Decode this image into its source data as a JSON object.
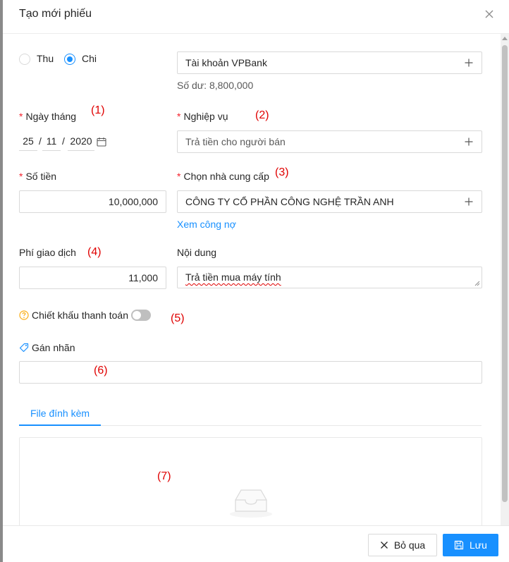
{
  "modal": {
    "title": "Tạo mới phiếu"
  },
  "type_radio": {
    "options": [
      {
        "label": "Thu",
        "checked": false
      },
      {
        "label": "Chi",
        "checked": true
      }
    ]
  },
  "account": {
    "value": "Tài khoản VPBank",
    "balance": "Số dư: 8,800,000"
  },
  "date_field": {
    "label": "Ngày tháng",
    "annotation": "(1)",
    "day": "25",
    "month": "11",
    "year": "2020",
    "separator": "/"
  },
  "operation": {
    "label": "Nghiệp vụ",
    "annotation": "(2)",
    "value": "Trả tiền cho người bán"
  },
  "amount": {
    "label": "Số tiền",
    "value": "10,000,000"
  },
  "supplier": {
    "label": "Chọn nhà cung cấp",
    "annotation": "(3)",
    "value": "CÔNG TY CỔ PHẦN CÔNG NGHỆ TRẦN ANH",
    "debt_link": "Xem công nợ"
  },
  "fee": {
    "label": "Phí giao dịch",
    "annotation": "(4)",
    "value": "11,000"
  },
  "content": {
    "label": "Nội dung",
    "value": "Trả tiền mua máy tính"
  },
  "discount": {
    "label": "Chiết khấu thanh toán",
    "annotation": "(5)",
    "enabled": false
  },
  "tags": {
    "label": "Gán nhãn",
    "annotation": "(6)"
  },
  "attachments": {
    "tab_label": "File đính kèm",
    "annotation": "(7)"
  },
  "footer": {
    "cancel_label": "Bỏ qua",
    "save_label": "Lưu"
  },
  "colors": {
    "primary": "#1890ff",
    "required": "#f5222d",
    "annotation": "#e00000",
    "help_icon": "#faad14"
  }
}
